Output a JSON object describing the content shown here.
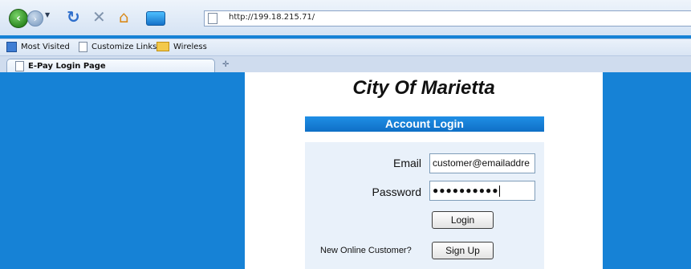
{
  "browser": {
    "url": "http://199.18.215.71/",
    "icons": {
      "back": "back-arrow-icon",
      "forward": "forward-arrow-icon",
      "reload": "reload-icon",
      "stop": "stop-icon",
      "home": "home-icon"
    },
    "bookmarks": [
      {
        "label": "Most Visited",
        "icon": "bookmarks-icon"
      },
      {
        "label": "Customize Links",
        "icon": "page-icon"
      },
      {
        "label": "Wireless",
        "icon": "folder-icon"
      }
    ],
    "tab": {
      "label": "E-Pay Login Page"
    }
  },
  "page": {
    "title": "City Of Marietta",
    "login_header": "Account Login",
    "email_label": "Email",
    "email_value": "customer@emailaddre",
    "password_label": "Password",
    "password_mask": "●●●●●●●●●●",
    "login_button": "Login",
    "new_customer_text": "New Online Customer?",
    "signup_button": "Sign Up"
  },
  "colors": {
    "page_background": "#1682d6",
    "header_blue": "#1f8fe6"
  }
}
